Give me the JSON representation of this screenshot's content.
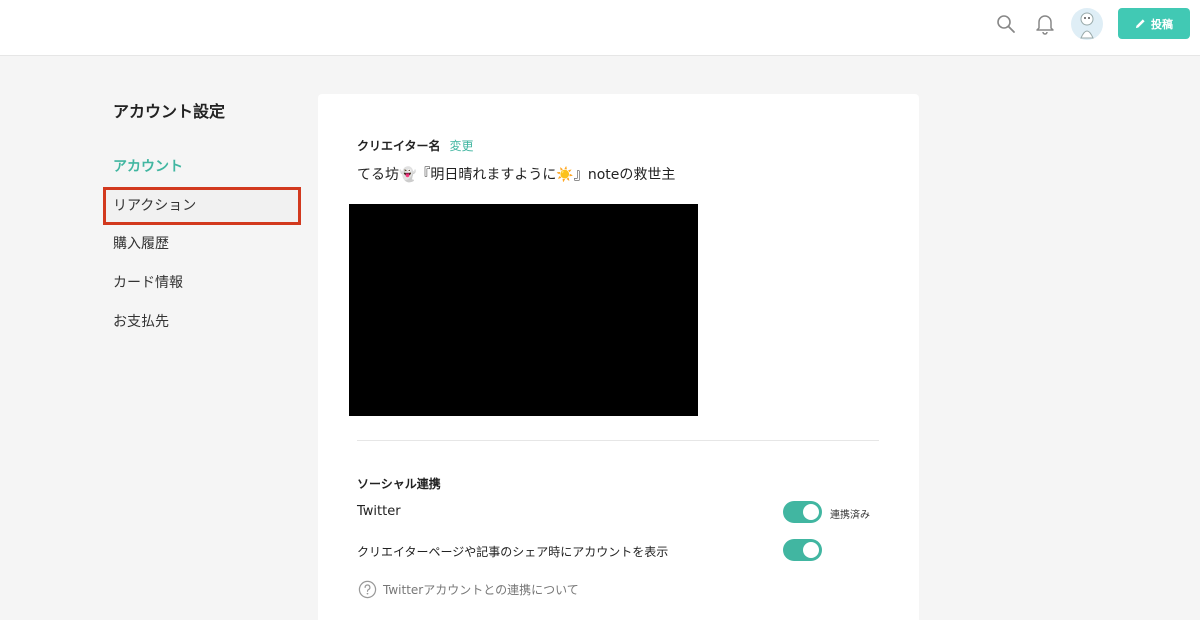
{
  "header": {
    "search_icon": "search-icon",
    "bell_icon": "bell-icon",
    "post_label": "投稿",
    "accent": "#41c9b4"
  },
  "sidebar": {
    "title": "アカウント設定",
    "items": [
      {
        "label": "アカウント",
        "state": "active"
      },
      {
        "label": "リアクション",
        "state": "highlighted"
      },
      {
        "label": "購入履歴",
        "state": "normal"
      },
      {
        "label": "カード情報",
        "state": "normal"
      },
      {
        "label": "お支払先",
        "state": "normal"
      }
    ],
    "active_color": "#41b6a1",
    "highlight_color": "#d2391e"
  },
  "main": {
    "creator_label": "クリエイター名",
    "change_link": "変更",
    "creator_name": "てる坊👻『明日晴れますように☀️』noteの救世主",
    "social_title": "ソーシャル連携",
    "twitter_label": "Twitter",
    "twitter_toggle_on": true,
    "linked_status": "連携済み",
    "share_label": "クリエイターページや記事のシェア時にアカウントを表示",
    "share_toggle_on": true,
    "help_text": "Twitterアカウントとの連携について"
  }
}
